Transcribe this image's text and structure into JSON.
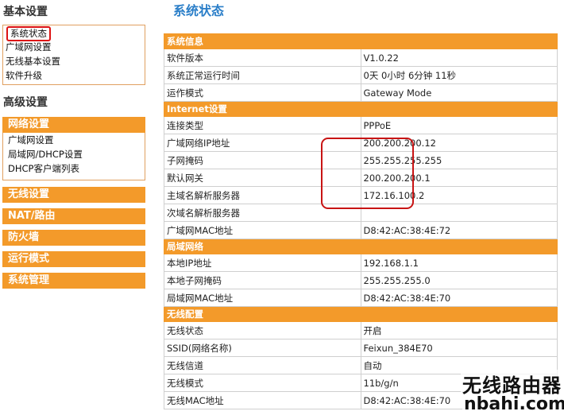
{
  "sidebar": {
    "basic_title": "基本设置",
    "basic_items": [
      "系统状态",
      "广域网设置",
      "无线基本设置",
      "软件升级"
    ],
    "advanced_title": "高级设置",
    "network_header": "网络设置",
    "network_items": [
      "广域网设置",
      "局域网/DHCP设置",
      "DHCP客户端列表"
    ],
    "wireless_btn": "无线设置",
    "nat_btn": "NAT/路由",
    "firewall_btn": "防火墙",
    "mode_btn": "运行模式",
    "sysmgmt_btn": "系统管理"
  },
  "page_title": "系统状态",
  "sections": {
    "system": "系统信息",
    "internet": "Internet设置",
    "lan": "局域网络",
    "wireless": "无线配置"
  },
  "rows": {
    "software_version": {
      "label": "软件版本",
      "value": "V1.0.22"
    },
    "uptime": {
      "label": "系统正常运行时间",
      "value": "0天  0小时  6分钟  11秒"
    },
    "run_mode": {
      "label": "运作模式",
      "value": "Gateway Mode"
    },
    "conn_type": {
      "label": "连接类型",
      "value": "PPPoE"
    },
    "wan_ip": {
      "label": "广域网络IP地址",
      "value": "200.200.200.12"
    },
    "subnet": {
      "label": "子网掩码",
      "value": "255.255.255.255"
    },
    "gateway": {
      "label": "默认网关",
      "value": "200.200.200.1"
    },
    "primary_dns": {
      "label": "主域名解析服务器",
      "value": "172.16.100.2"
    },
    "secondary_dns": {
      "label": "次域名解析服务器",
      "value": ""
    },
    "wan_mac": {
      "label": "广域网MAC地址",
      "value": "D8:42:AC:38:4E:72"
    },
    "lan_ip": {
      "label": "本地IP地址",
      "value": "192.168.1.1"
    },
    "lan_mask": {
      "label": "本地子网掩码",
      "value": "255.255.255.0"
    },
    "lan_mac": {
      "label": "局域网MAC地址",
      "value": "D8:42:AC:38:4E:70"
    },
    "wl_status": {
      "label": "无线状态",
      "value": "开启"
    },
    "ssid": {
      "label": "SSID(网络名称)",
      "value": "Feixun_384E70"
    },
    "channel": {
      "label": "无线信道",
      "value": "自动"
    },
    "wl_mode": {
      "label": "无线模式",
      "value": "11b/g/n"
    },
    "wl_mac": {
      "label": "无线MAC地址",
      "value": "D8:42:AC:38:4E:70"
    }
  },
  "watermark": {
    "cn": "无线路由器",
    "en": "nbahi.com"
  },
  "colors": {
    "accent_orange": "#f39a2a",
    "title_blue": "#2a7ec8",
    "highlight_red": "#c81414"
  }
}
